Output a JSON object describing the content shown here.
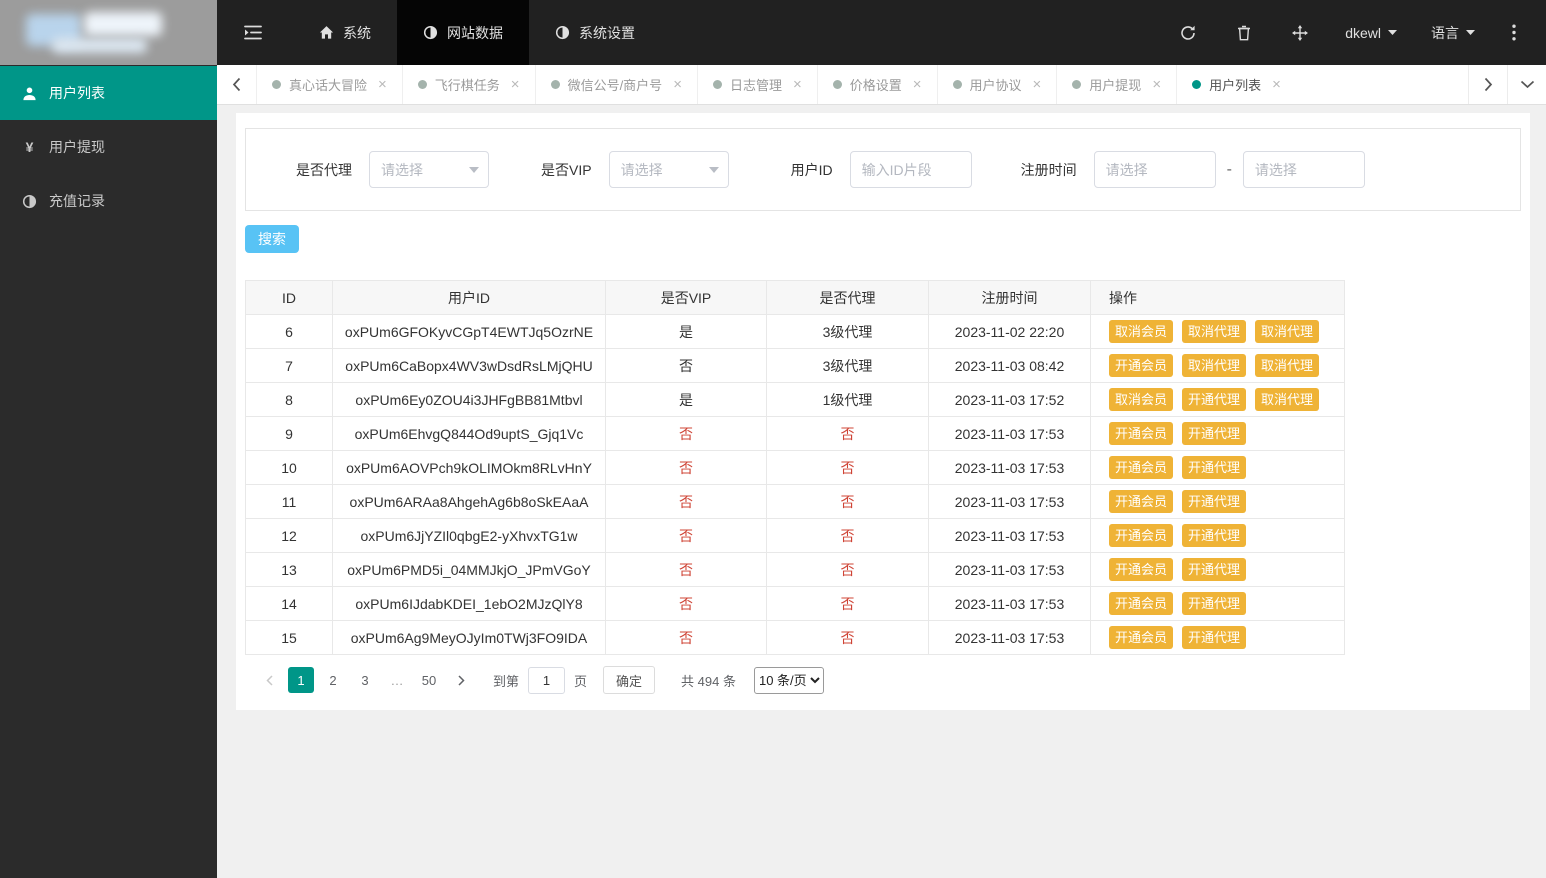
{
  "colors": {
    "accent_teal": "#009688",
    "topbar_bg": "#212121",
    "sidebar_bg": "#2b2b2b",
    "search_button_blue": "#58c3f5",
    "action_button_orange": "#efb336",
    "danger_red": "#cf4436"
  },
  "topbar": {
    "nav": [
      {
        "label": "系统",
        "icon": "home"
      },
      {
        "label": "网站数据",
        "icon": "half-circle",
        "active": true
      },
      {
        "label": "系统设置",
        "icon": "half-circle",
        "active": false
      }
    ],
    "username": "dkewl",
    "language_label": "语言"
  },
  "sidebar": {
    "items": [
      {
        "key": "user-list",
        "label": "用户列表",
        "icon": "user",
        "active": true
      },
      {
        "key": "user-withdraw",
        "label": "用户提现",
        "icon": "yen",
        "active": false
      },
      {
        "key": "recharge-records",
        "label": "充值记录",
        "icon": "half-circle",
        "active": false
      }
    ]
  },
  "ui": {
    "close_glyph": "×"
  },
  "tabs": [
    {
      "label": "真心话大冒险",
      "active": false
    },
    {
      "label": "飞行棋任务",
      "active": false
    },
    {
      "label": "微信公号/商户号",
      "active": false
    },
    {
      "label": "日志管理",
      "active": false
    },
    {
      "label": "价格设置",
      "active": false
    },
    {
      "label": "用户协议",
      "active": false
    },
    {
      "label": "用户提现",
      "active": false
    },
    {
      "label": "用户列表",
      "active": true
    }
  ],
  "filters": {
    "agent_label": "是否代理",
    "agent_placeholder": "请选择",
    "vip_label": "是否VIP",
    "vip_placeholder": "请选择",
    "userid_label": "用户ID",
    "userid_placeholder": "输入ID片段",
    "regtime_label": "注册时间",
    "regtime_start_placeholder": "请选择",
    "regtime_end_placeholder": "请选择",
    "range_separator": "-",
    "search_label": "搜索"
  },
  "table": {
    "headers": [
      "ID",
      "用户ID",
      "是否VIP",
      "是否代理",
      "注册时间",
      "操作"
    ],
    "rows": [
      {
        "id": "6",
        "user_id": "oxPUm6GFOKyvCGpT4EWTJq5OzrNE",
        "vip": {
          "text": "是",
          "red": false
        },
        "agent": {
          "text": "3级代理",
          "red": false
        },
        "reg_time": "2023-11-02 22:20",
        "actions": [
          "取消会员",
          "取消代理",
          "取消代理"
        ]
      },
      {
        "id": "7",
        "user_id": "oxPUm6CaBopx4WV3wDsdRsLMjQHU",
        "vip": {
          "text": "否",
          "red": false
        },
        "agent": {
          "text": "3级代理",
          "red": false
        },
        "reg_time": "2023-11-03 08:42",
        "actions": [
          "开通会员",
          "取消代理",
          "取消代理"
        ]
      },
      {
        "id": "8",
        "user_id": "oxPUm6Ey0ZOU4i3JHFgBB81Mtbvl",
        "vip": {
          "text": "是",
          "red": false
        },
        "agent": {
          "text": "1级代理",
          "red": false
        },
        "reg_time": "2023-11-03 17:52",
        "actions": [
          "取消会员",
          "开通代理",
          "取消代理"
        ]
      },
      {
        "id": "9",
        "user_id": "oxPUm6EhvgQ844Od9uptS_Gjq1Vc",
        "vip": {
          "text": "否",
          "red": true
        },
        "agent": {
          "text": "否",
          "red": true
        },
        "reg_time": "2023-11-03 17:53",
        "actions": [
          "开通会员",
          "开通代理"
        ]
      },
      {
        "id": "10",
        "user_id": "oxPUm6AOVPch9kOLIMOkm8RLvHnY",
        "vip": {
          "text": "否",
          "red": true
        },
        "agent": {
          "text": "否",
          "red": true
        },
        "reg_time": "2023-11-03 17:53",
        "actions": [
          "开通会员",
          "开通代理"
        ]
      },
      {
        "id": "11",
        "user_id": "oxPUm6ARAa8AhgehAg6b8oSkEAaA",
        "vip": {
          "text": "否",
          "red": true
        },
        "agent": {
          "text": "否",
          "red": true
        },
        "reg_time": "2023-11-03 17:53",
        "actions": [
          "开通会员",
          "开通代理"
        ]
      },
      {
        "id": "12",
        "user_id": "oxPUm6JjYZIl0qbgE2-yXhvxTG1w",
        "vip": {
          "text": "否",
          "red": true
        },
        "agent": {
          "text": "否",
          "red": true
        },
        "reg_time": "2023-11-03 17:53",
        "actions": [
          "开通会员",
          "开通代理"
        ]
      },
      {
        "id": "13",
        "user_id": "oxPUm6PMD5i_04MMJkjO_JPmVGoY",
        "vip": {
          "text": "否",
          "red": true
        },
        "agent": {
          "text": "否",
          "red": true
        },
        "reg_time": "2023-11-03 17:53",
        "actions": [
          "开通会员",
          "开通代理"
        ]
      },
      {
        "id": "14",
        "user_id": "oxPUm6IJdabKDEI_1ebO2MJzQlY8",
        "vip": {
          "text": "否",
          "red": true
        },
        "agent": {
          "text": "否",
          "red": true
        },
        "reg_time": "2023-11-03 17:53",
        "actions": [
          "开通会员",
          "开通代理"
        ]
      },
      {
        "id": "15",
        "user_id": "oxPUm6Ag9MeyOJyIm0TWj3FO9IDA",
        "vip": {
          "text": "否",
          "red": true
        },
        "agent": {
          "text": "否",
          "red": true
        },
        "reg_time": "2023-11-03 17:53",
        "actions": [
          "开通会员",
          "开通代理"
        ]
      }
    ]
  },
  "pagination": {
    "pages": [
      "1",
      "2",
      "3",
      "…",
      "50"
    ],
    "active_page": "1",
    "ellipsis": "…",
    "goto_label": "到第",
    "goto_value": "1",
    "page_unit_label": "页",
    "confirm_label": "确定",
    "total_label": "共 494 条",
    "per_page": "10 条/页"
  }
}
